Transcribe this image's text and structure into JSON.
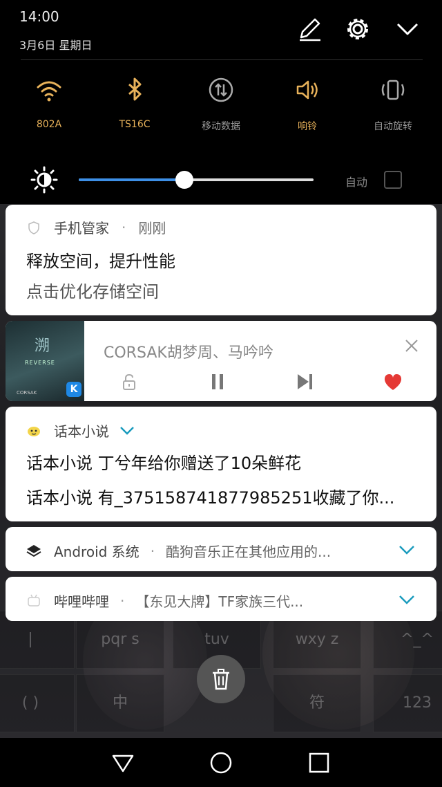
{
  "status": {
    "time": "14:00",
    "date": "3月6日 星期日"
  },
  "quick_settings": [
    {
      "label": "802A",
      "icon": "wifi-icon",
      "active": true
    },
    {
      "label": "TS16C",
      "icon": "bluetooth-icon",
      "active": true
    },
    {
      "label": "移动数据",
      "icon": "mobile-data-icon",
      "active": false
    },
    {
      "label": "响铃",
      "icon": "ring-icon",
      "active": true
    },
    {
      "label": "自动旋转",
      "icon": "auto-rotate-icon",
      "active": false
    }
  ],
  "brightness": {
    "level_percent": 45,
    "auto_label": "自动",
    "auto_enabled": false
  },
  "notifications": {
    "phone_manager": {
      "app": "手机管家",
      "time": "刚刚",
      "title": "释放空间，提升性能",
      "body": "点击优化存储空间"
    },
    "music": {
      "title": "CORSAK胡梦周、马吟吟",
      "album_text_1": "溯",
      "album_text_2": "REVERSE",
      "album_text_3": "CORSAK"
    },
    "novel": {
      "app": "话本小说",
      "line1": "话本小说 丁兮年给你赠送了10朵鲜花",
      "line2": "话本小说 有_375158741877985251收藏了你..."
    },
    "android": {
      "app": "Android 系统",
      "text": "酷狗音乐正在其他应用的..."
    },
    "bilibili": {
      "app": "哔哩哔哩",
      "text": "【东见大牌】TF家族三代..."
    }
  },
  "background_keys": [
    "pqr s",
    "tuv",
    "wxy z",
    "^_^",
    "( )",
    "中",
    "符",
    "123"
  ],
  "colors": {
    "accent_on": "#e8b25a",
    "slider": "#3d8fe6",
    "chevron": "#1a9bbd",
    "heart": "#e53935"
  }
}
